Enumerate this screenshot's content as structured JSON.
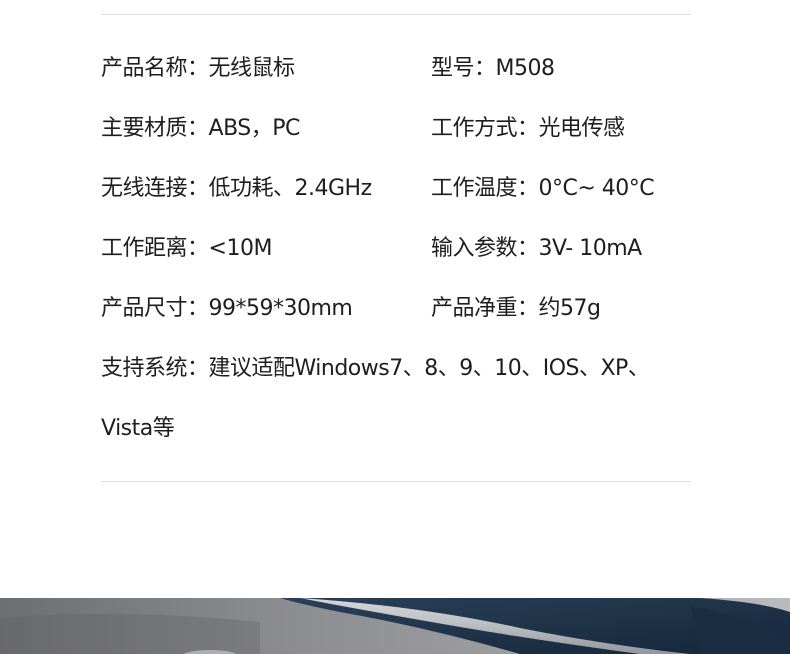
{
  "specs": {
    "name": {
      "label": "产品名称：",
      "value": "无线鼠标"
    },
    "model": {
      "label": "型号：",
      "value": "M508"
    },
    "material": {
      "label": "主要材质：",
      "value": "ABS，PC"
    },
    "working_mode": {
      "label": "工作方式：",
      "value": "光电传感"
    },
    "wireless": {
      "label": "无线连接：",
      "value": "低功耗、2.4GHz"
    },
    "temperature": {
      "label": "工作温度：",
      "value": "0°C~ 40°C"
    },
    "range": {
      "label": "工作距离：",
      "value": "<10M"
    },
    "input": {
      "label": "输入参数：",
      "value": "3V- 10mA"
    },
    "size": {
      "label": "产品尺寸：",
      "value": "99*59*30mm"
    },
    "weight": {
      "label": "产品净重：",
      "value": "约57g"
    },
    "systems": {
      "label": "支持系统：",
      "value": "建议适配Windows7、8、9、10、IOS、XP、",
      "value_cont": "Vista等"
    }
  },
  "colors": {
    "text": "#1e1e1e",
    "rule": "#dcdcdc",
    "photo_gray": "#7f8184",
    "photo_navy": "#1f3347"
  }
}
